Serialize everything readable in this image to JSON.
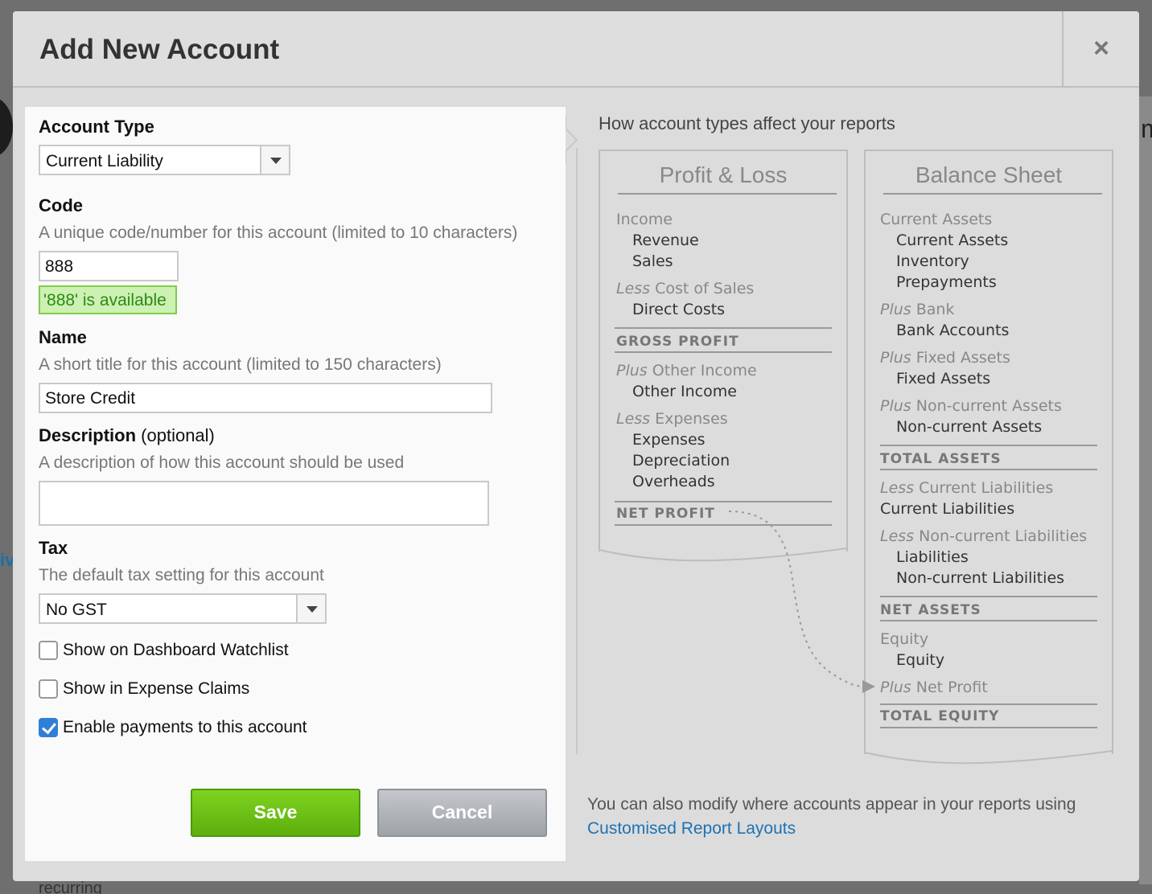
{
  "background": {
    "bottom_text": "recurring",
    "right_letter": "m",
    "left_text": "iv"
  },
  "modal": {
    "title": "Add New Account",
    "close_glyph": "×"
  },
  "form": {
    "account_type": {
      "label": "Account Type",
      "value": "Current Liability"
    },
    "code": {
      "label": "Code",
      "hint": "A unique code/number for this account (limited to 10 characters)",
      "value": "888",
      "availability": "'888' is available"
    },
    "name": {
      "label": "Name",
      "hint": "A short title for this account (limited to 150 characters)",
      "value": "Store Credit"
    },
    "description": {
      "label": "Description",
      "optional": "(optional)",
      "hint": "A description of how this account should be used",
      "value": ""
    },
    "tax": {
      "label": "Tax",
      "hint": "The default tax setting for this account",
      "value": "No GST"
    },
    "checkboxes": [
      {
        "label": "Show on Dashboard Watchlist",
        "checked": false
      },
      {
        "label": "Show in Expense Claims",
        "checked": false
      },
      {
        "label": "Enable payments to this account",
        "checked": true
      }
    ],
    "save_label": "Save",
    "cancel_label": "Cancel"
  },
  "reports": {
    "title": "How account types affect your reports",
    "profit_loss": {
      "title": "Profit & Loss",
      "income": "Income",
      "revenue": "Revenue",
      "sales": "Sales",
      "less": "Less",
      "cost_of_sales": "Cost of Sales",
      "direct_costs": "Direct Costs",
      "gross_profit": "GROSS PROFIT",
      "plus": "Plus",
      "other_income_group": "Other Income",
      "other_income": "Other Income",
      "expenses_group": "Expenses",
      "expenses": "Expenses",
      "depreciation": "Depreciation",
      "overheads": "Overheads",
      "net_profit": "NET PROFIT"
    },
    "balance_sheet": {
      "title": "Balance Sheet",
      "current_assets_group": "Current Assets",
      "current_assets": "Current Assets",
      "inventory": "Inventory",
      "prepayments": "Prepayments",
      "plus": "Plus",
      "less": "Less",
      "bank_group": "Bank",
      "bank_accounts": "Bank Accounts",
      "fixed_assets_group": "Fixed Assets",
      "fixed_assets": "Fixed Assets",
      "noncurrent_assets_group": "Non-current Assets",
      "noncurrent_assets": "Non-current Assets",
      "total_assets": "TOTAL ASSETS",
      "current_liabilities_group": "Current Liabilities",
      "current_liabilities": "Current Liabilities",
      "noncurrent_liabilities_group": "Non-current Liabilities",
      "liabilities": "Liabilities",
      "noncurrent_liabilities": "Non-current Liabilities",
      "net_assets": "NET ASSETS",
      "equity_group": "Equity",
      "equity": "Equity",
      "net_profit": "Net Profit",
      "total_equity": "TOTAL EQUITY"
    },
    "footer_text": "You can also modify where accounts appear in your reports using",
    "footer_link": "Customised Report Layouts"
  }
}
